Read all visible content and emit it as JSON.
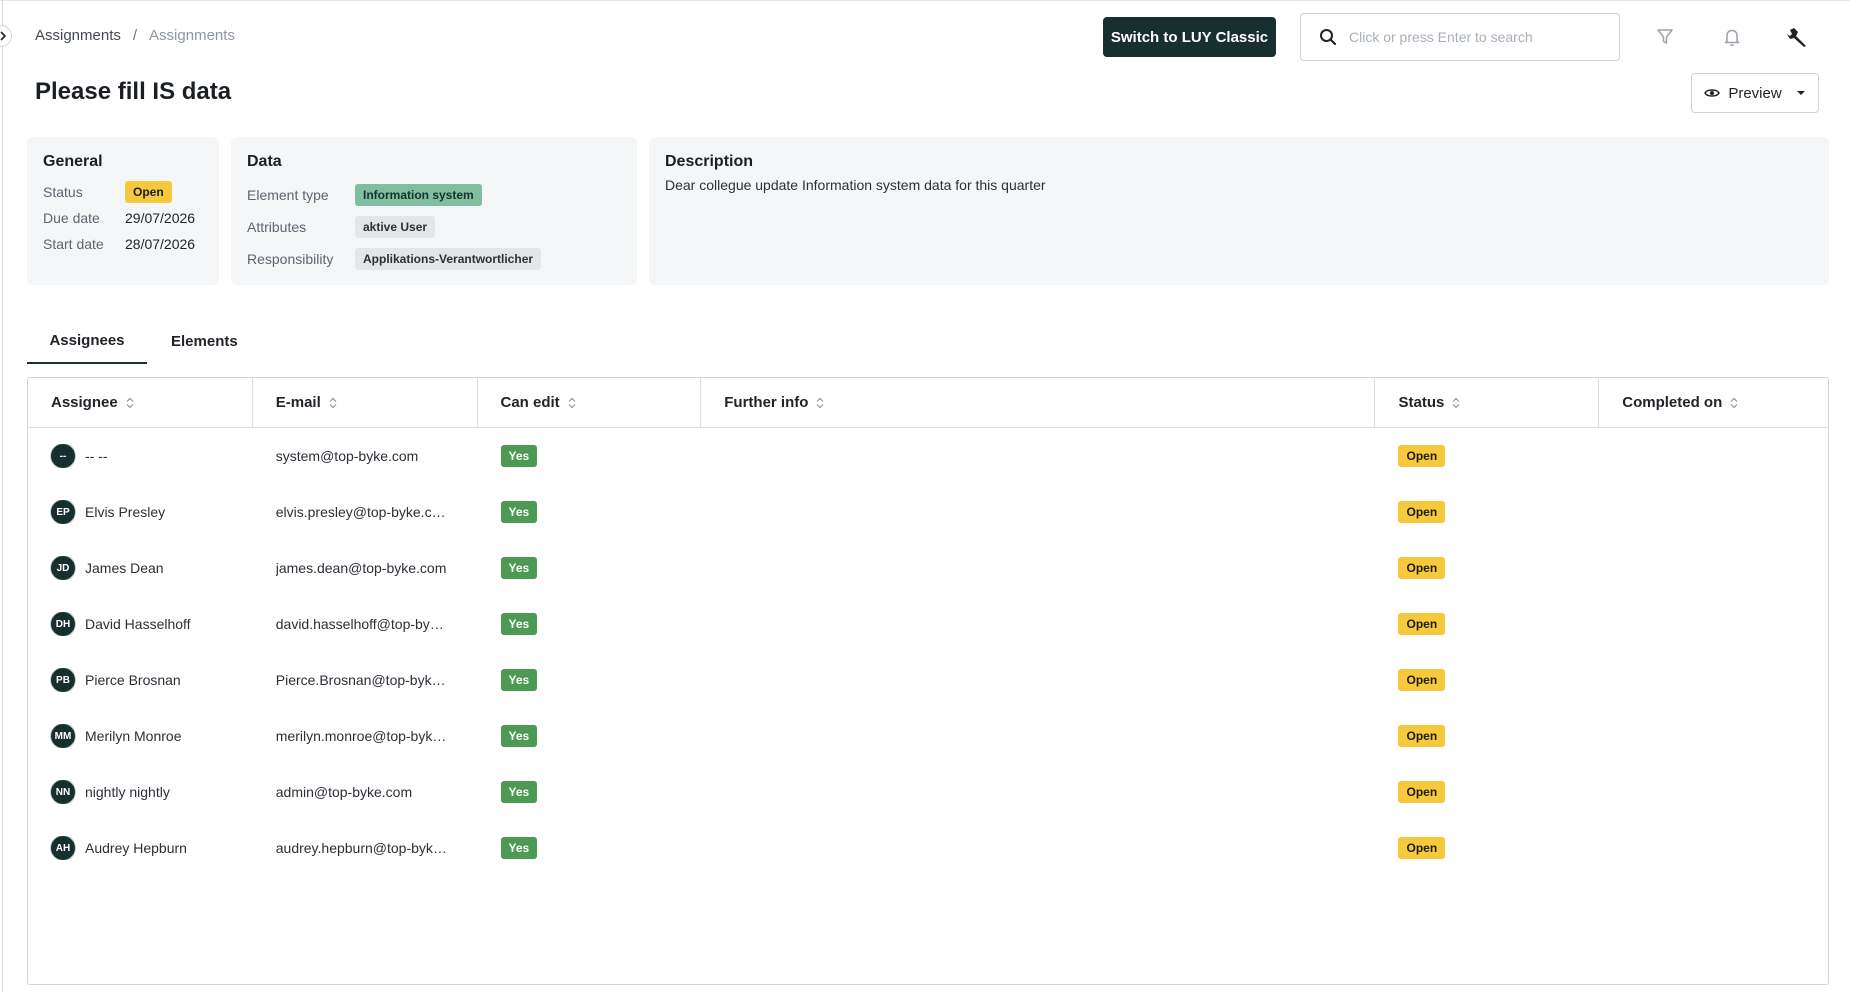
{
  "breadcrumb": {
    "parent": "Assignments",
    "separator": "/",
    "current": "Assignments"
  },
  "header": {
    "switch_label": "Switch to LUY Classic",
    "search_placeholder": "Click or press Enter to search",
    "icons": [
      "filter-icon",
      "bell-icon",
      "wrench-icon"
    ]
  },
  "page": {
    "title": "Please fill IS data",
    "preview_label": "Preview"
  },
  "general": {
    "title": "General",
    "status_label": "Status",
    "status_value": "Open",
    "due_label": "Due date",
    "due_value": "29/07/2026",
    "start_label": "Start date",
    "start_value": "28/07/2026"
  },
  "data_card": {
    "title": "Data",
    "element_type_label": "Element type",
    "element_type_value": "Information system",
    "attributes_label": "Attributes",
    "attributes_value": "aktive User",
    "responsibility_label": "Responsibility",
    "responsibility_value": "Applikations-Verantwortlicher"
  },
  "description": {
    "title": "Description",
    "text": "Dear collegue update Information system data for this quarter"
  },
  "tabs": {
    "assignees": "Assignees",
    "elements": "Elements"
  },
  "table": {
    "columns": [
      "Assignee",
      "E-mail",
      "Can edit",
      "Further info",
      "Status",
      "Completed on"
    ],
    "rows": [
      {
        "initials": "--",
        "name": "-- --",
        "email": "system@top-byke.com",
        "can_edit": "Yes",
        "further": "",
        "status": "Open",
        "completed": ""
      },
      {
        "initials": "EP",
        "name": "Elvis Presley",
        "email": "elvis.presley@top-byke.com",
        "can_edit": "Yes",
        "further": "",
        "status": "Open",
        "completed": ""
      },
      {
        "initials": "JD",
        "name": "James Dean",
        "email": "james.dean@top-byke.com",
        "can_edit": "Yes",
        "further": "",
        "status": "Open",
        "completed": ""
      },
      {
        "initials": "DH",
        "name": "David Hasselhoff",
        "email": "david.hasselhoff@top-byke.com",
        "can_edit": "Yes",
        "further": "",
        "status": "Open",
        "completed": ""
      },
      {
        "initials": "PB",
        "name": "Pierce Brosnan",
        "email": "Pierce.Brosnan@top-byke.com",
        "can_edit": "Yes",
        "further": "",
        "status": "Open",
        "completed": ""
      },
      {
        "initials": "MM",
        "name": "Merilyn Monroe",
        "email": "merilyn.monroe@top-byke.com",
        "can_edit": "Yes",
        "further": "",
        "status": "Open",
        "completed": ""
      },
      {
        "initials": "NN",
        "name": "nightly nightly",
        "email": "admin@top-byke.com",
        "can_edit": "Yes",
        "further": "",
        "status": "Open",
        "completed": ""
      },
      {
        "initials": "AH",
        "name": "Audrey Hepburn",
        "email": "audrey.hepburn@top-byke.com",
        "can_edit": "Yes",
        "further": "",
        "status": "Open",
        "completed": ""
      }
    ]
  }
}
